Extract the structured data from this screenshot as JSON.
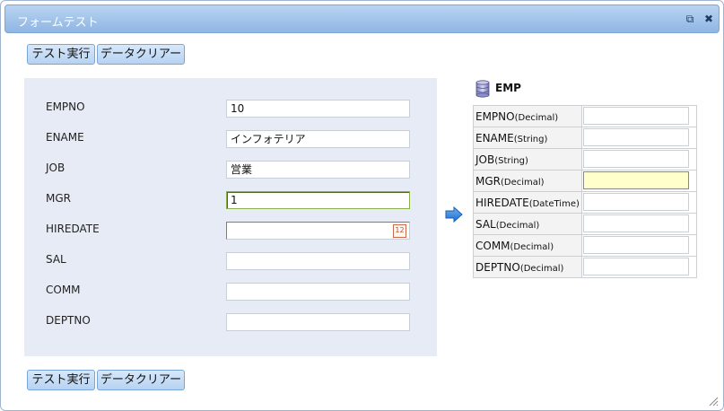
{
  "window": {
    "title": "フォームテスト"
  },
  "toolbar": {
    "run_label": "テスト実行",
    "clear_label": "データクリアー"
  },
  "form": {
    "fields": [
      {
        "label": "EMPNO",
        "value": "10"
      },
      {
        "label": "ENAME",
        "value": "インフォテリア"
      },
      {
        "label": "JOB",
        "value": "営業"
      },
      {
        "label": "MGR",
        "value": "1"
      },
      {
        "label": "HIREDATE",
        "value": ""
      },
      {
        "label": "SAL",
        "value": ""
      },
      {
        "label": "COMM",
        "value": ""
      },
      {
        "label": "DEPTNO",
        "value": ""
      }
    ]
  },
  "emp": {
    "title": "EMP",
    "rows": [
      {
        "name": "EMPNO",
        "type": "(Decimal)"
      },
      {
        "name": "ENAME",
        "type": "(String)"
      },
      {
        "name": "JOB",
        "type": "(String)"
      },
      {
        "name": "MGR",
        "type": "(Decimal)"
      },
      {
        "name": "HIREDATE",
        "type": "(DateTime)"
      },
      {
        "name": "SAL",
        "type": "(Decimal)"
      },
      {
        "name": "COMM",
        "type": "(Decimal)"
      },
      {
        "name": "DEPTNO",
        "type": "(Decimal)"
      }
    ]
  },
  "icons": {
    "calendar_text": "12"
  },
  "colors": {
    "titlebar": "#8fb6e3",
    "panel": "#e7ebf6",
    "button": "#b6d3f2",
    "active_cell": "#ffffcc"
  }
}
